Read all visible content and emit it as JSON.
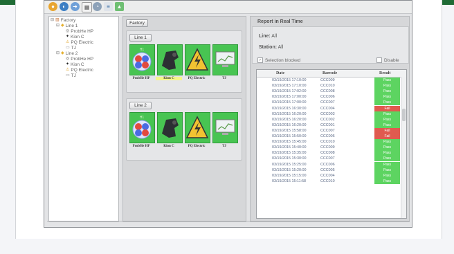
{
  "colors": {
    "accent_bar": "#1f6b35",
    "tile_green": "#48c452",
    "pass": "#5dd461",
    "fail": "#e05a4f"
  },
  "toolbar": {
    "icons": [
      "users-icon",
      "globe-icon",
      "arrow-icon",
      "calendar-icon",
      "gauge-icon",
      "list-icon",
      "folder-icon"
    ]
  },
  "tree": {
    "root": "Factory",
    "lines": [
      {
        "label": "Line 1",
        "stations": [
          "ProbHe HP",
          "Kion C",
          "PQ Electric",
          "TJ"
        ]
      },
      {
        "label": "Line 2",
        "stations": [
          "ProbHe HP",
          "Kion C",
          "PQ Electric",
          "TJ"
        ]
      }
    ]
  },
  "factory_panel": {
    "factory_button": "Factory",
    "lines": [
      {
        "button": "Line 1",
        "tiles": [
          {
            "label": "ProbHe HP",
            "badge": "H1",
            "icon": "sphere-icon"
          },
          {
            "label": "Kion C",
            "icon": "machine-icon",
            "highlight": true
          },
          {
            "label": "PQ Electric",
            "icon": "warning-icon"
          },
          {
            "label": "TJ",
            "icon": "monitor-icon"
          }
        ]
      },
      {
        "button": "Line 2",
        "tiles": [
          {
            "label": "ProbHe HP",
            "badge": "H1",
            "icon": "sphere-icon"
          },
          {
            "label": "Kion C",
            "icon": "machine-icon"
          },
          {
            "label": "PQ Electric",
            "icon": "warning-icon"
          },
          {
            "label": "TJ",
            "icon": "monitor-icon"
          }
        ]
      }
    ]
  },
  "realtime": {
    "title": "Report in Real Time",
    "line_label": "Line:",
    "line_value": "All",
    "station_label": "Station:",
    "station_value": "All",
    "selection_blocked": "Selection blocked",
    "disable": "Disable",
    "columns": [
      "Date",
      "Barcode",
      "Result"
    ],
    "rows": [
      {
        "date": "03/19/2015 17:10:00",
        "barcode": "CCC009",
        "result": "Pass"
      },
      {
        "date": "03/19/2015 17:10:00",
        "barcode": "CCC010",
        "result": "Pass"
      },
      {
        "date": "03/19/2015 17:02:00",
        "barcode": "CCC008",
        "result": "Pass"
      },
      {
        "date": "03/19/2015 17:00:00",
        "barcode": "CCC006",
        "result": "Pass"
      },
      {
        "date": "03/19/2015 17:00:00",
        "barcode": "CCC007",
        "result": "Pass"
      },
      {
        "date": "03/19/2015 16:30:00",
        "barcode": "CCC004",
        "result": "Fail"
      },
      {
        "date": "03/19/2015 16:20:00",
        "barcode": "CCC003",
        "result": "Pass"
      },
      {
        "date": "03/19/2015 16:20:00",
        "barcode": "CCC002",
        "result": "Pass"
      },
      {
        "date": "03/19/2015 16:20:00",
        "barcode": "CCC001",
        "result": "Pass"
      },
      {
        "date": "03/19/2015 15:58:00",
        "barcode": "CCC007",
        "result": "Fail"
      },
      {
        "date": "03/19/2015 15:50:00",
        "barcode": "CCC006",
        "result": "Fail"
      },
      {
        "date": "03/19/2015 15:45:00",
        "barcode": "CCC010",
        "result": "Pass"
      },
      {
        "date": "03/19/2015 15:40:00",
        "barcode": "CCC009",
        "result": "Pass"
      },
      {
        "date": "03/19/2015 15:35:00",
        "barcode": "CCC008",
        "result": "Pass"
      },
      {
        "date": "03/19/2015 15:30:00",
        "barcode": "CCC007",
        "result": "Pass"
      },
      {
        "date": "03/19/2015 15:25:00",
        "barcode": "CCC006",
        "result": "Pass"
      },
      {
        "date": "03/19/2015 15:20:00",
        "barcode": "CCC005",
        "result": "Pass"
      },
      {
        "date": "03/19/2015 15:15:00",
        "barcode": "CCC004",
        "result": "Pass"
      },
      {
        "date": "03/19/2015 15:11:58",
        "barcode": "CCC010",
        "result": "Pass"
      }
    ]
  }
}
